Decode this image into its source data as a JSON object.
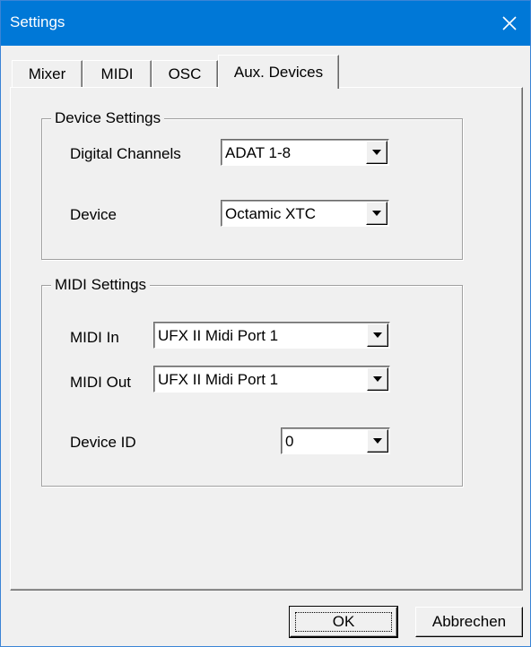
{
  "window": {
    "title": "Settings",
    "close_icon": "close-icon",
    "titlebar_color": "#0078d7"
  },
  "tabs": [
    {
      "label": "Mixer",
      "active": false
    },
    {
      "label": "MIDI",
      "active": false
    },
    {
      "label": "OSC",
      "active": false
    },
    {
      "label": "Aux. Devices",
      "active": true
    }
  ],
  "device_settings": {
    "title": "Device Settings",
    "digital_channels": {
      "label": "Digital Channels",
      "value": "ADAT 1-8"
    },
    "device": {
      "label": "Device",
      "value": "Octamic XTC"
    }
  },
  "midi_settings": {
    "title": "MIDI Settings",
    "midi_in": {
      "label": "MIDI In",
      "value": "UFX II Midi Port 1"
    },
    "midi_out": {
      "label": "MIDI Out",
      "value": "UFX II Midi Port 1"
    },
    "device_id": {
      "label": "Device ID",
      "value": "0"
    }
  },
  "buttons": {
    "ok": "OK",
    "cancel": "Abbrechen"
  }
}
